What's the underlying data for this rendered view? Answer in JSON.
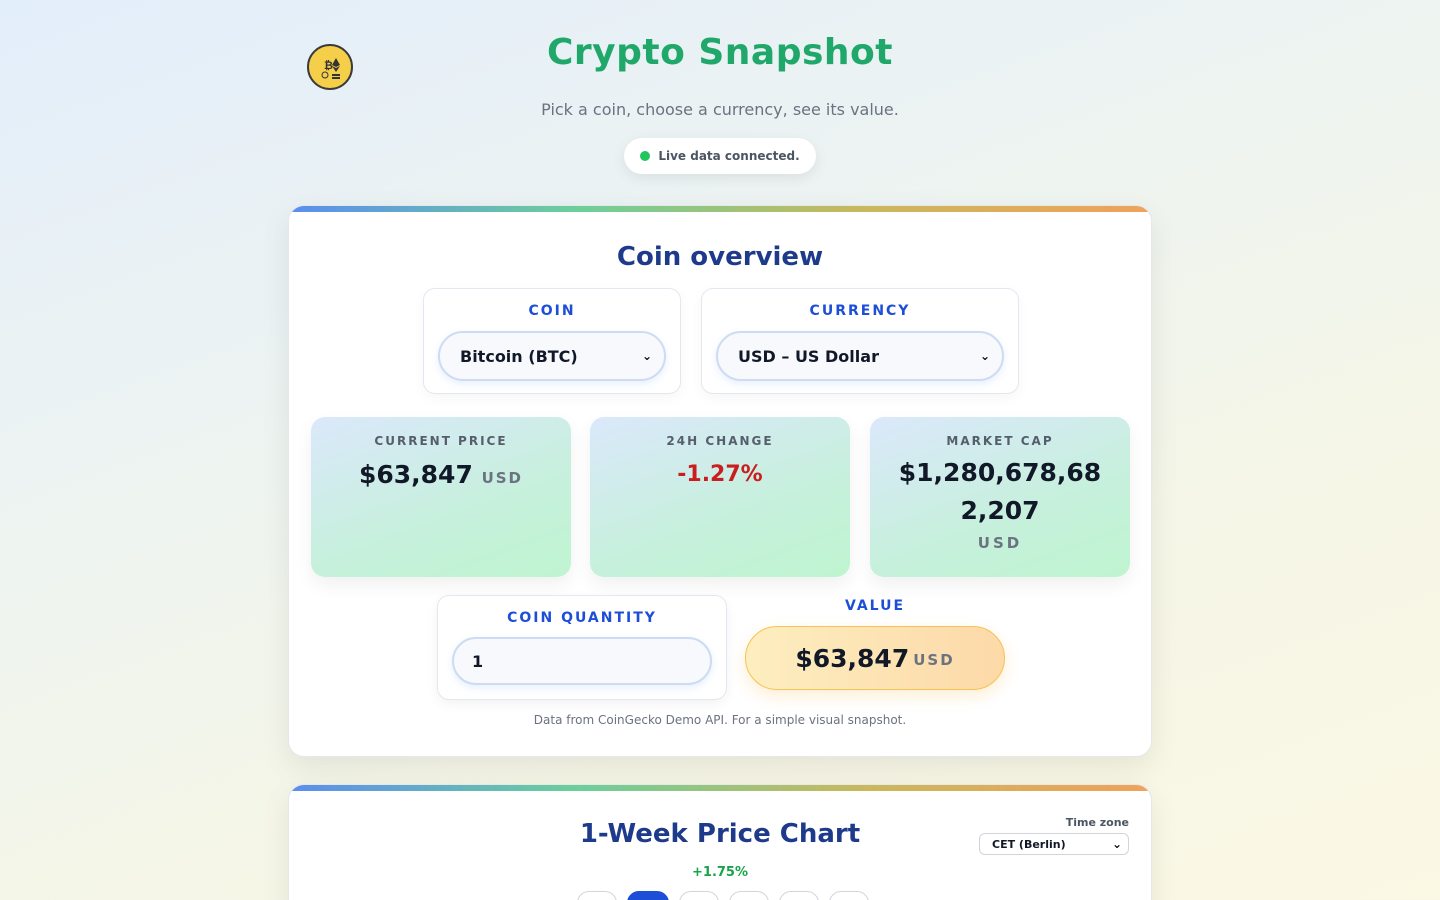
{
  "header": {
    "title": "Crypto Snapshot",
    "subtitle": "Pick a coin, choose a currency, see its value.",
    "status": "Live data connected.",
    "logo_icon": "crypto-logo-icon"
  },
  "overview": {
    "title": "Coin overview",
    "coin_label": "COIN",
    "coin_selected": "Bitcoin (BTC)",
    "currency_label": "CURRENCY",
    "currency_selected": "USD – US Dollar",
    "stats": {
      "price_label": "CURRENT PRICE",
      "price_value": "$63,847",
      "price_unit": "USD",
      "change_label": "24H CHANGE",
      "change_value": "-1.27%",
      "mcap_label": "MARKET CAP",
      "mcap_value": "$1,280,678,682,207",
      "mcap_unit": "USD"
    },
    "quantity_label": "COIN QUANTITY",
    "quantity_value": "1",
    "value_label": "VALUE",
    "value_amount": "$63,847",
    "value_unit": "USD",
    "footnote": "Data from CoinGecko Demo API. For a simple visual snapshot."
  },
  "chart": {
    "title": "1-Week Price Chart",
    "timezone_label": "Time zone",
    "timezone_selected": "CET (Berlin)",
    "change": "+1.75%"
  },
  "colors": {
    "title_green": "#20a86a",
    "heading_blue": "#1e3a8a",
    "label_blue": "#1d4ed8",
    "negative": "#c81e1e",
    "positive": "#16a34a"
  }
}
